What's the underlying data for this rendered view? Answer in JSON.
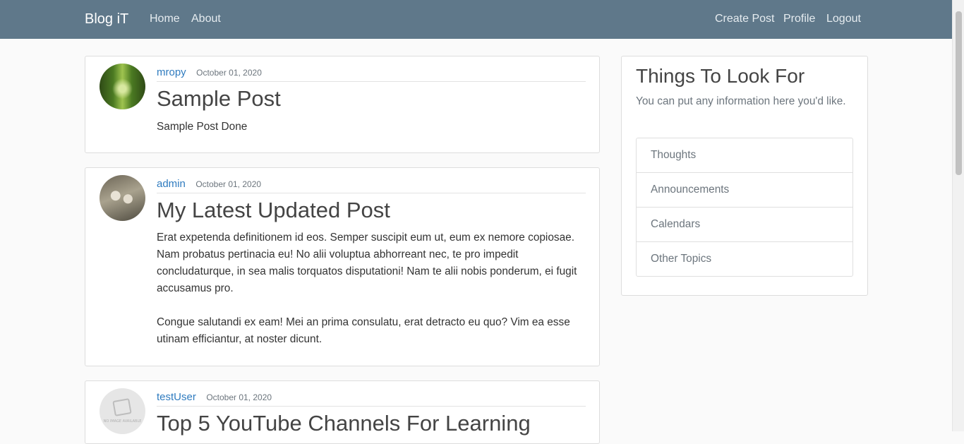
{
  "navbar": {
    "brand": "Blog iT",
    "left_links": [
      "Home",
      "About"
    ],
    "right_links": [
      "Create Post",
      "Profile",
      "Logout"
    ]
  },
  "posts": [
    {
      "author": "mropy",
      "date": "October 01, 2020",
      "title": "Sample Post",
      "paragraphs": [
        "Sample Post Done"
      ],
      "avatar_icon": "forest-path-photo"
    },
    {
      "author": "admin",
      "date": "October 01, 2020",
      "title": "My Latest Updated Post",
      "paragraphs": [
        "Erat expetenda definitionem id eos. Semper suscipit eum ut, eum ex nemore copiosae. Nam probatus pertinacia eu! No alii voluptua abhorreant nec, te pro impedit concludaturque, in sea malis torquatos disputationi! Nam te alii nobis ponderum, ei fugit accusamus pro.",
        "Congue salutandi ex eam! Mei an prima consulatu, erat detracto eu quo? Vim ea esse utinam efficiantur, at noster dicunt."
      ],
      "avatar_icon": "birds-photo"
    },
    {
      "author": "testUser",
      "date": "October 01, 2020",
      "title": "Top 5 YouTube Channels For Learning",
      "paragraphs": [],
      "avatar_icon": "no-image-placeholder",
      "avatar_text": "NO IMAGE AVAILABLE"
    }
  ],
  "sidebar": {
    "title": "Things To Look For",
    "text": "You can put any information here you'd like.",
    "items": [
      "Thoughts",
      "Announcements",
      "Calendars",
      "Other Topics"
    ]
  },
  "colors": {
    "navbar": "#5f788a",
    "link": "#2f7bbf",
    "muted": "#6c757d"
  }
}
